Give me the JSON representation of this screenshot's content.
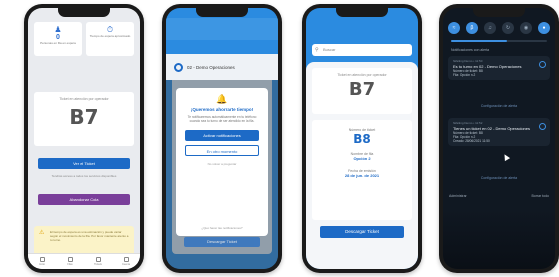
{
  "phone1": {
    "stats": [
      {
        "icon": "user-group-icon",
        "value": "0",
        "label": "Personas en fila en espera"
      },
      {
        "icon": "timer-icon",
        "value": "",
        "label": "Tiempo de espera aproximado"
      }
    ],
    "ticket_caption": "Ticket en atención por operador",
    "ticket_code": "B7",
    "view_ticket": "Ver el Ticket",
    "note": "Tendrás acceso a todos los servicios disponibles",
    "leave_queue": "Abandonar Cola",
    "warning": "El tiempo de espera es una estimación y puede variar según el movimiento de la fila. Por favor mantente atento a tu turno.",
    "tabs": [
      "Inicio",
      "Filas",
      "Tickets",
      "Cuenta"
    ]
  },
  "phone2": {
    "header_title": "02 - Demo Operaciones",
    "modal_title": "¡Queremos ahorrarte tiempo!",
    "modal_text": "Te notificaremos automáticamente en tu teléfono cuando sea tu turno de ser atendido en la fila.",
    "btn_activate": "Activar notificaciones",
    "btn_later": "En otro momento",
    "modal_foot": "No volver a preguntar",
    "modal_foot2": "¿Qué hacer las notificaciones?",
    "bottom_btn": "Descargar Ticket"
  },
  "phone3": {
    "search_placeholder": "Buscar",
    "ticket_caption": "Ticket en atención por operador",
    "ticket_code": "B7",
    "number_label": "Número de ticket",
    "number_value": "B8",
    "service_label": "Nombre de fila",
    "service_value": "Opción 2",
    "date_label": "Fecha de emisión",
    "date_value": "28 de jun. de 2021",
    "download_btn": "Descargar Ticket"
  },
  "phone4": {
    "quick_settings": [
      "wifi-icon",
      "bluetooth-icon",
      "sound-icon",
      "rotate-icon",
      "bell-icon",
      "flashlight-icon"
    ],
    "brightness": 0.58,
    "section_head": "Notificaciones con alerta",
    "notifications": [
      {
        "app": "iWaiting Demo • 11:50",
        "title": "Es tu turno en 02 - Demo Operaciones",
        "lines": [
          "Número de ticket: B8",
          "Fila: Opción n.2"
        ]
      },
      {
        "app": "iWaiting Demo • 11:52",
        "title": "Tienes un ticket en 02 - Demo Operaciones",
        "lines": [
          "Número de ticket: B8",
          "Fila: Opción n.2",
          "Creado: 28/06/2021 11:50"
        ]
      }
    ],
    "settings_link": "Configuración de alerta",
    "footer_left": "Administrar",
    "footer_right": "Borrar todo"
  }
}
